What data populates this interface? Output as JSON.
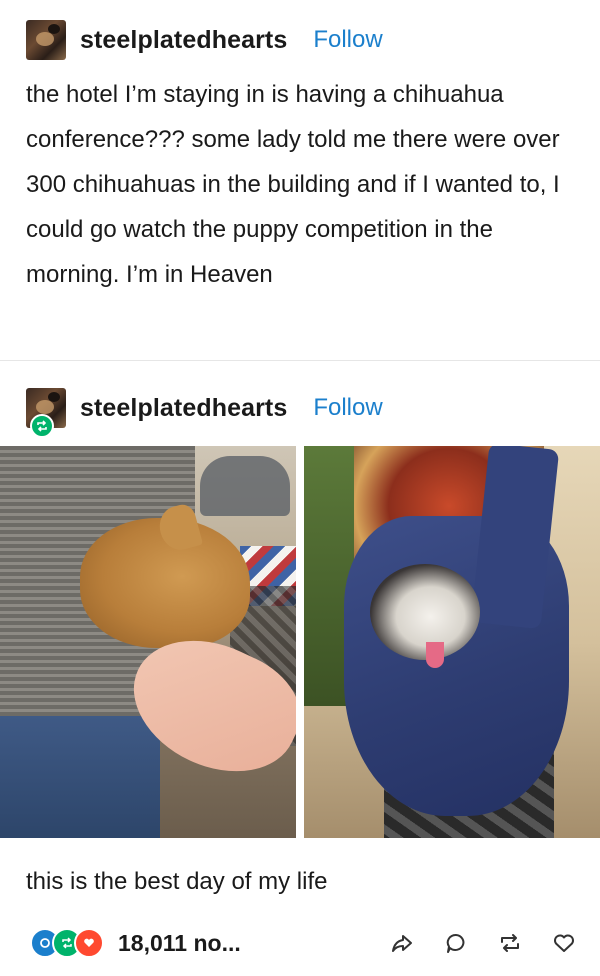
{
  "post": {
    "author": "steelplatedhearts",
    "follow_label": "Follow",
    "text": "the hotel I’m staying in is having a chihuahua conference??? some lady told me there were over 300 chihuahuas in the building and if I wanted to, I could go watch the puppy competition in the morning. I’m in Heaven"
  },
  "reblog": {
    "author": "steelplatedhearts",
    "follow_label": "Follow",
    "caption": "this is the best day of my life"
  },
  "footer": {
    "notes_count": "18,011 no...",
    "icons": [
      "share-icon",
      "reply-icon",
      "reblog-icon",
      "like-icon"
    ]
  },
  "colors": {
    "follow": "#1b7fcc",
    "reblog_badge": "#00b36b",
    "note_blue": "#1b7fcc",
    "note_green": "#00b36b",
    "note_red": "#ff4930"
  }
}
